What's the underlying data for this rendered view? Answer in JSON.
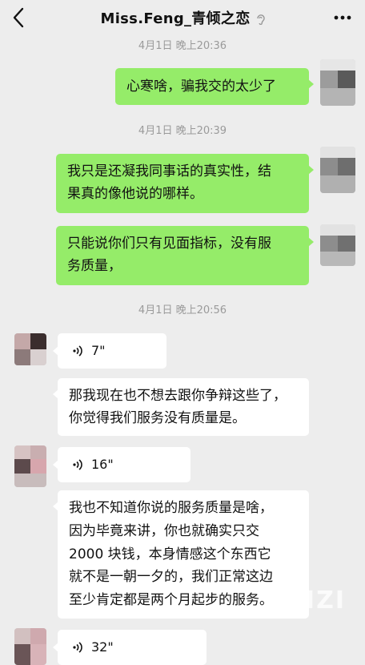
{
  "header": {
    "title": "Miss.Feng_青倾之恋",
    "back_icon": "chevron-left-icon",
    "more_icon": "ellipsis-icon",
    "status_icon": "ear-icon"
  },
  "timestamps": [
    "4月1日 晚上20:36",
    "4月1日 晚上20:39",
    "4月1日 晚上20:56"
  ],
  "messages": {
    "m1": "心寒啥，骗我交的太少了",
    "m2_l1": "我只是还凝我同事话的真实性，结",
    "m2_l2": "果真的像他说的哪样。",
    "m3_l1": "只能说你们只有见面指标，没有服",
    "m3_l2": "务质量，",
    "v1": "7\"",
    "m4_l1": "那我现在也不想去跟你争辩这些了，",
    "m4_l2": "你觉得我们服务没有质量是。",
    "v2": "16\"",
    "m5_l1": "我也不知道你说的服务质量是啥，",
    "m5_l2": "因为毕竟来讲，你也就确实只交",
    "m5_l3": "2000 块钱，本身情感这个东西它",
    "m5_l4": "就不是一朝一夕的，我们正常这边",
    "m5_l5": "至少肯定都是两个月起步的服务。",
    "v3": "32\""
  },
  "watermark": "XIZI",
  "colors": {
    "sent_bubble": "#95ec69",
    "received_bubble": "#ffffff",
    "background": "#ededed"
  }
}
